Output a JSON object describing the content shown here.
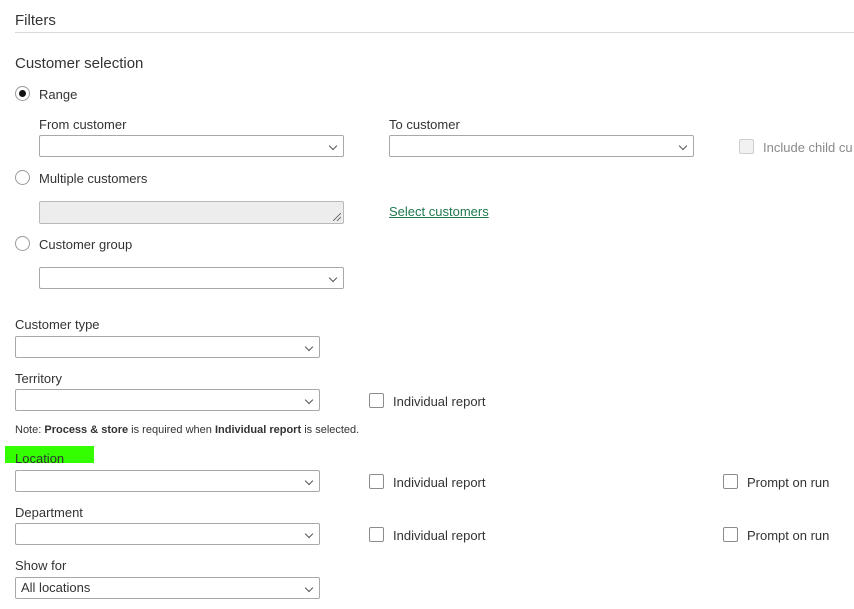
{
  "filters": {
    "title": "Filters",
    "customer_selection": {
      "heading": "Customer selection",
      "range": {
        "label": "Range",
        "selected": true,
        "from_label": "From customer",
        "from_value": "",
        "to_label": "To customer",
        "to_value": "",
        "include_child_label": "Include child cu",
        "include_child_checked": false,
        "include_child_disabled": true
      },
      "multiple": {
        "label": "Multiple customers",
        "selected": false,
        "select_link": "Select customers"
      },
      "group": {
        "label": "Customer group",
        "selected": false,
        "value": ""
      }
    },
    "customer_type": {
      "label": "Customer type",
      "value": ""
    },
    "territory": {
      "label": "Territory",
      "value": "",
      "individual_report_label": "Individual report",
      "individual_report_checked": false
    },
    "note": {
      "prefix": "Note: ",
      "strong1": "Process & store",
      "middle": " is required when ",
      "strong2": "Individual report",
      "suffix": " is selected."
    },
    "location": {
      "label": "Location",
      "value": "",
      "individual_report_label": "Individual report",
      "prompt_label": "Prompt on run",
      "highlight_color": "#33ff00"
    },
    "department": {
      "label": "Department",
      "value": "",
      "individual_report_label": "Individual report",
      "prompt_label": "Prompt on run"
    },
    "show_for": {
      "label": "Show for",
      "value": "All locations"
    }
  },
  "colors": {
    "link": "#1f7a4d",
    "border": "#a8a8a8",
    "text": "#333333"
  }
}
